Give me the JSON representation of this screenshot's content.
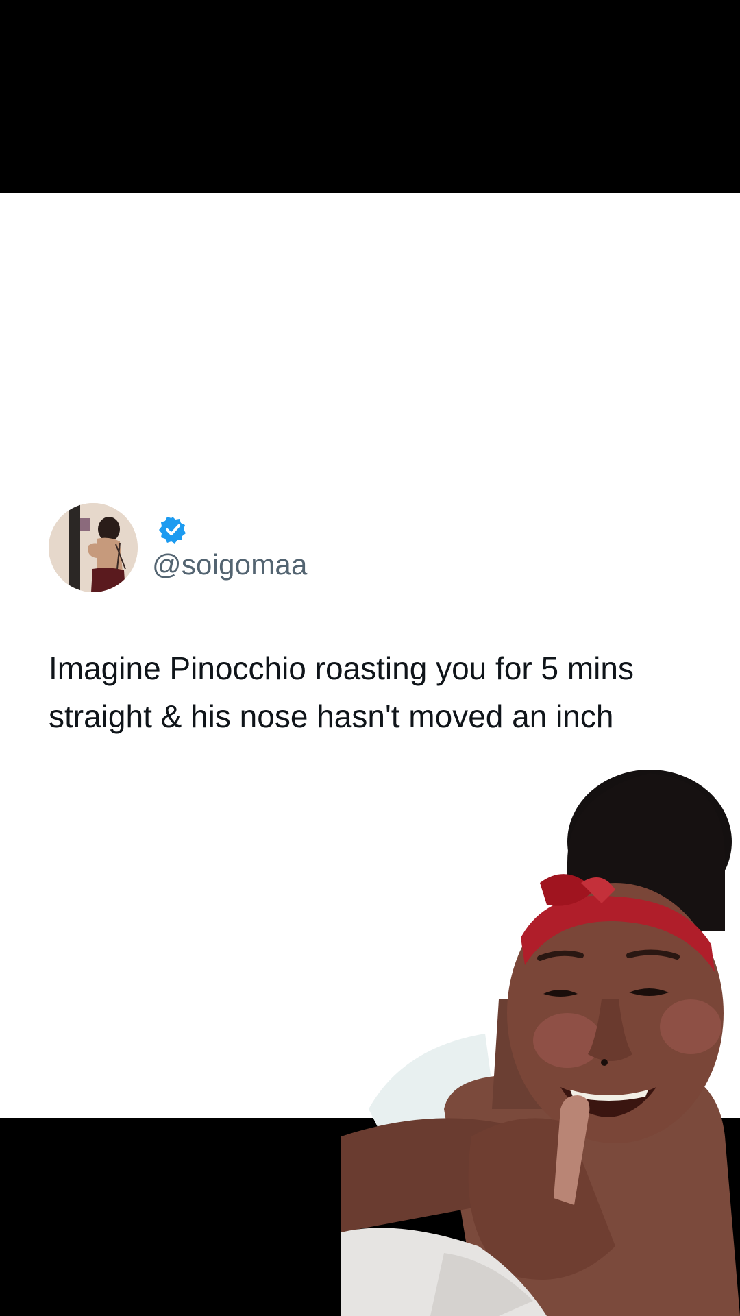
{
  "tweet": {
    "handle": "@soigomaa",
    "verified_icon": "verified-badge-icon",
    "verified_color": "#1d9bf0",
    "text_lines": [
      "Imagine Pinocchio roasting you for 5 mins",
      "straight & his nose hasn't moved an inch"
    ]
  },
  "colors": {
    "background_bars": "#000000",
    "card": "#ffffff",
    "handle": "#536471",
    "text": "#0f1419",
    "headband": "#b01e2a"
  }
}
